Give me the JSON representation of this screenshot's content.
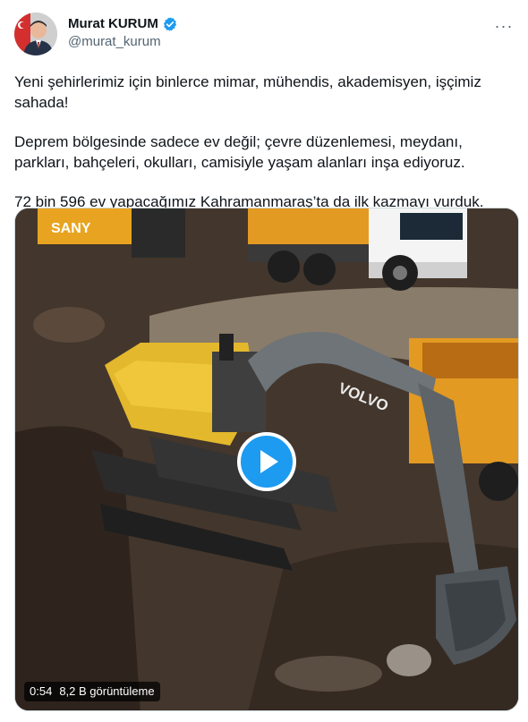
{
  "author": {
    "display_name": "Murat KURUM",
    "handle": "@murat_kurum",
    "verified_icon": "verified-badge-icon",
    "verified_color": "#1d9bf0"
  },
  "tweet": {
    "paragraphs": [
      "Yeni şehirlerimiz için binlerce mimar, mühendis, akademisyen, işçimiz sahada!",
      "Deprem bölgesinde sadece ev değil; çevre düzenlemesi, meydanı, parkları, bahçeleri, okulları, camisiyle yaşam alanları inşa ediyoruz.",
      "72 bin 596 ev yapacağımız Kahramanmaraş’ta da ilk kazmayı vurduk."
    ]
  },
  "media": {
    "duration": "0:54",
    "views": "8,2 B görüntüleme",
    "brand_left": "SANY",
    "brand_excavator": "VOLVO",
    "play_icon": "play-icon",
    "accent": "#1d9bf0"
  },
  "menu": {
    "more_icon": "more-options-icon",
    "more_label": "···"
  }
}
